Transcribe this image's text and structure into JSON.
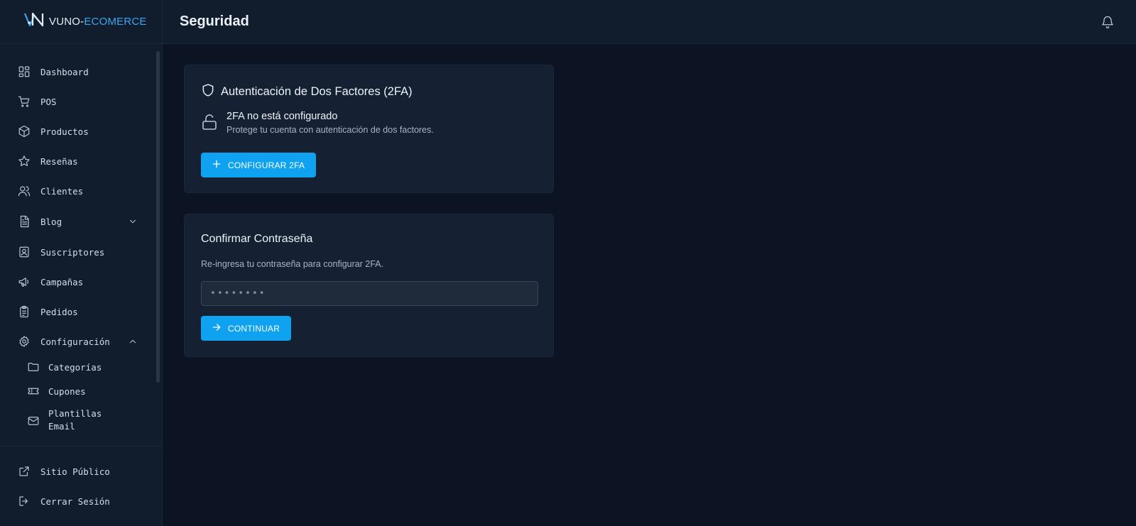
{
  "brand": {
    "name_part1": "VUNO-",
    "name_part2": "ECOMERCE"
  },
  "header": {
    "title": "Seguridad"
  },
  "sidebar": {
    "items": [
      {
        "label": "Dashboard",
        "icon": "dashboard-icon"
      },
      {
        "label": "POS",
        "icon": "cart-icon"
      },
      {
        "label": "Productos",
        "icon": "box-icon"
      },
      {
        "label": "Reseñas",
        "icon": "star-icon"
      },
      {
        "label": "Clientes",
        "icon": "users-icon"
      },
      {
        "label": "Blog",
        "icon": "document-icon"
      },
      {
        "label": "Suscriptores",
        "icon": "contact-card-icon"
      },
      {
        "label": "Campañas",
        "icon": "megaphone-icon"
      },
      {
        "label": "Pedidos",
        "icon": "clipboard-icon"
      },
      {
        "label": "Configuración",
        "icon": "gear-icon"
      }
    ],
    "sub_items": [
      {
        "label": "Categorías",
        "icon": "folder-icon"
      },
      {
        "label": "Cupones",
        "icon": "ticket-icon"
      },
      {
        "label_line1": "Plantillas",
        "label_line2": "Email",
        "icon": "mail-icon"
      }
    ],
    "footer": [
      {
        "label": "Sitio Público",
        "icon": "external-link-icon"
      },
      {
        "label": "Cerrar Sesión",
        "icon": "logout-icon"
      }
    ]
  },
  "twofa_card": {
    "title": "Autenticación de Dos Factores (2FA)",
    "status_title": "2FA no está configurado",
    "status_desc": "Protege tu cuenta con autenticación de dos factores.",
    "button_label": "CONFIGURAR 2FA"
  },
  "password_card": {
    "title": "Confirmar Contraseña",
    "desc": "Re-ingresa tu contraseña para configurar 2FA.",
    "input_placeholder": "••••••••",
    "input_value": "",
    "button_label": "CONTINUAR"
  },
  "colors": {
    "accent": "#0ea2f0",
    "background": "#0c1424",
    "sidebar": "#111c2d",
    "card": "#152133"
  }
}
